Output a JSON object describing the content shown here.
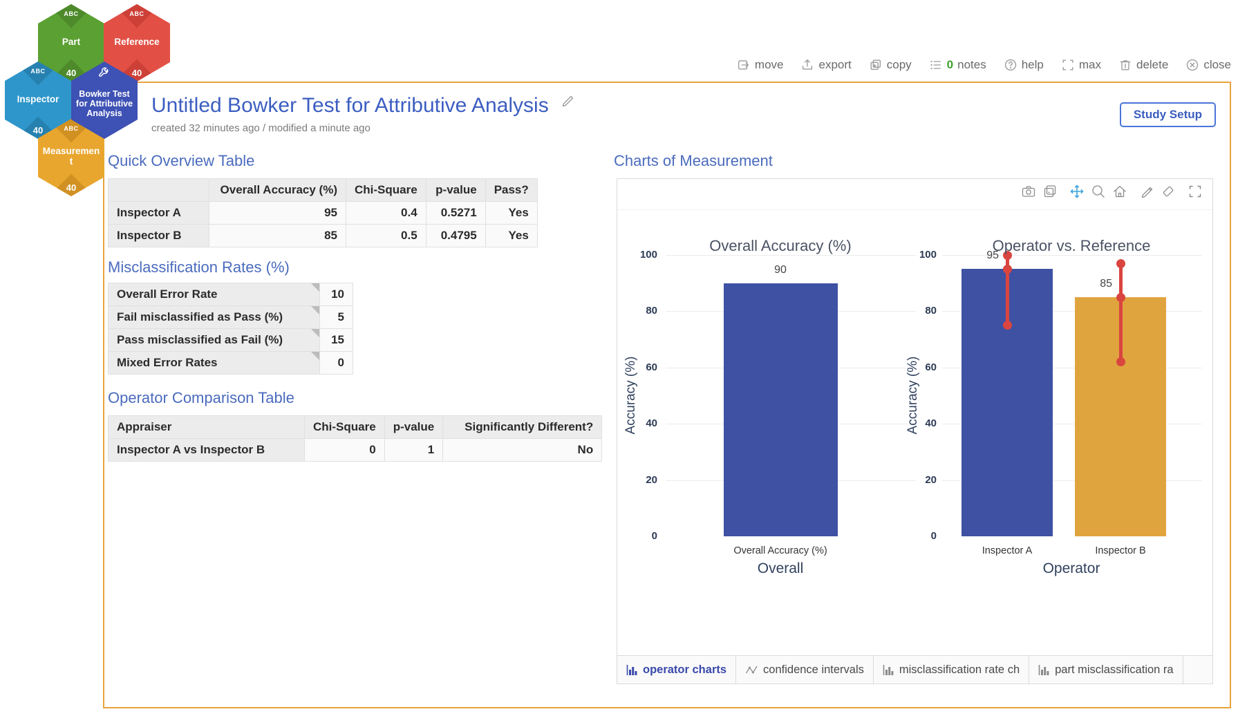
{
  "hex_cluster": {
    "nodes": [
      {
        "id": "part",
        "label": "Part",
        "badge_top": "ABC",
        "badge_bottom": "40",
        "color": "#5ba033",
        "color_dark": "#4e8a2b"
      },
      {
        "id": "reference",
        "label": "Reference",
        "badge_top": "ABC",
        "badge_bottom": "40",
        "color": "#e25045",
        "color_dark": "#cd4038"
      },
      {
        "id": "inspector",
        "label": "Inspector",
        "badge_top": "ABC",
        "badge_bottom": "40",
        "color": "#2e96ca",
        "color_dark": "#2781b0"
      },
      {
        "id": "measurement",
        "label": "Measurement",
        "badge_top": "ABC",
        "badge_bottom": "40",
        "color": "#e9a62e",
        "color_dark": "#d19122"
      },
      {
        "id": "bowker-test",
        "label": "Bowker Test for Attributive Analysis",
        "icon": "wrench",
        "color": "#3e51b4",
        "color_dark": "#3545a0"
      }
    ]
  },
  "window_toolbar": {
    "items": [
      {
        "id": "move",
        "label": "move"
      },
      {
        "id": "export",
        "label": "export"
      },
      {
        "id": "copy",
        "label": "copy"
      },
      {
        "id": "notes",
        "label": "notes",
        "count": "0",
        "count_color": "#3da02c"
      },
      {
        "id": "help",
        "label": "help"
      },
      {
        "id": "max",
        "label": "max"
      },
      {
        "id": "delete",
        "label": "delete"
      },
      {
        "id": "close",
        "label": "close"
      }
    ]
  },
  "header": {
    "title": "Untitled Bowker Test for Attributive Analysis",
    "subtitle": "created 32 minutes ago / modified a minute ago",
    "study_setup_label": "Study Setup"
  },
  "quick_overview": {
    "title": "Quick Overview Table",
    "columns": [
      "",
      "Overall Accuracy (%)",
      "Chi-Square",
      "p-value",
      "Pass?"
    ],
    "rows": [
      [
        "Inspector A",
        "95",
        "0.4",
        "0.5271",
        "Yes"
      ],
      [
        "Inspector B",
        "85",
        "0.5",
        "0.4795",
        "Yes"
      ]
    ]
  },
  "misclassification": {
    "title": "Misclassification Rates (%)",
    "rows": [
      [
        "Overall Error Rate",
        "10"
      ],
      [
        "Fail misclassified as Pass (%)",
        "5"
      ],
      [
        "Pass misclassified as Fail (%)",
        "15"
      ],
      [
        "Mixed Error Rates",
        "0"
      ]
    ]
  },
  "operator_comparison": {
    "title": "Operator Comparison Table",
    "columns": [
      "Appraiser",
      "Chi-Square",
      "p-value",
      "Significantly Different?"
    ],
    "rows": [
      [
        "Inspector A vs Inspector B",
        "0",
        "1",
        "No"
      ]
    ]
  },
  "charts_section": {
    "title": "Charts of Measurement",
    "modebar": [
      "camera",
      "copy-stack",
      "pan",
      "zoom",
      "home",
      "pencil",
      "eraser",
      "fullscreen"
    ],
    "active_modebar": "pan",
    "accent_color": "#3949ab",
    "tabs": [
      {
        "label": "operator charts",
        "icon": "bar-chart",
        "active": true
      },
      {
        "label": "confidence intervals",
        "icon": "line-chart",
        "active": false
      },
      {
        "label": "misclassification rate ch",
        "icon": "bar-chart",
        "active": false
      },
      {
        "label": "part misclassification ra",
        "icon": "bar-chart",
        "active": false
      }
    ]
  },
  "chart_data": [
    {
      "type": "bar",
      "title": "Overall Accuracy (%)",
      "xlabel": "Overall",
      "ylabel": "Accuracy (%)",
      "categories": [
        "Overall Accuracy (%)"
      ],
      "values": [
        90
      ],
      "data_labels": [
        "90"
      ],
      "bar_colors": [
        "#3f51a3"
      ],
      "ylim": [
        0,
        100
      ],
      "yticks": [
        0,
        20,
        40,
        60,
        80,
        100
      ],
      "grid": true,
      "legend": false
    },
    {
      "type": "bar",
      "title": "Operator vs. Reference",
      "xlabel": "Operator",
      "ylabel": "Accuracy (%)",
      "categories": [
        "Inspector A",
        "Inspector B"
      ],
      "values": [
        95,
        85
      ],
      "data_labels": [
        "95",
        "85"
      ],
      "bar_colors": [
        "#3f51a3",
        "#e0a43f"
      ],
      "error_bars": [
        {
          "low": 75,
          "high": 100
        },
        {
          "low": 62,
          "high": 97
        }
      ],
      "error_color": "#d9453f",
      "ylim": [
        0,
        100
      ],
      "yticks": [
        0,
        20,
        40,
        60,
        80,
        100
      ],
      "grid": true,
      "legend": false
    }
  ]
}
